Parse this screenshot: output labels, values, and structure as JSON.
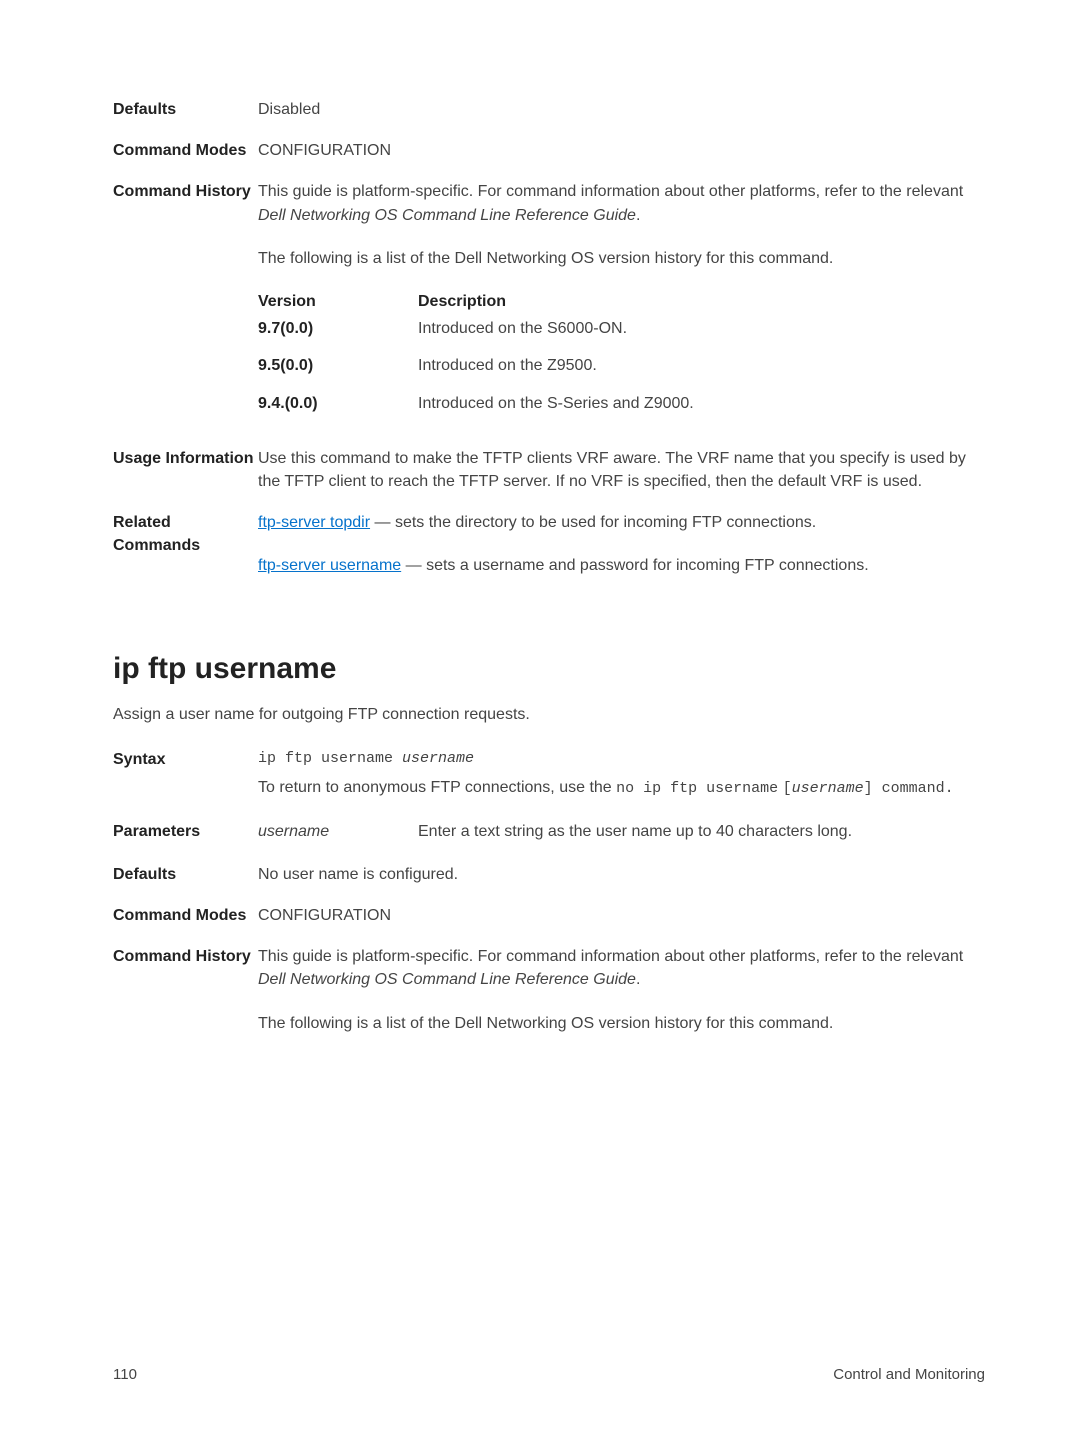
{
  "section1": {
    "defaults": {
      "label": "Defaults",
      "value": "Disabled"
    },
    "command_modes": {
      "label": "Command Modes",
      "value": "CONFIGURATION"
    },
    "command_history": {
      "label": "Command History",
      "intro_a": "This guide is platform-specific. For command information about other platforms, refer to the relevant ",
      "intro_italic": "Dell Networking OS Command Line Reference Guide",
      "intro_b": ".",
      "following": "The following is a list of the Dell Networking OS version history for this command.",
      "table": {
        "version_header": "Version",
        "description_header": "Description",
        "rows": [
          {
            "version": "9.7(0.0)",
            "description": "Introduced on the S6000-ON."
          },
          {
            "version": "9.5(0.0)",
            "description": "Introduced on the Z9500."
          },
          {
            "version": "9.4.(0.0)",
            "description": "Introduced on the S-Series and Z9000."
          }
        ]
      }
    },
    "usage_info": {
      "label": "Usage Information",
      "text": "Use this command to make the TFTP clients VRF aware. The VRF name that you specify is used by the TFTP client to reach the TFTP server. If no VRF is specified, then the default VRF is used."
    },
    "related_commands": {
      "label": "Related Commands",
      "item1_link": "ftp-server topdir",
      "item1_rest": " — sets the directory to be used for incoming FTP connections.",
      "item2_link": "ftp-server username",
      "item2_rest": " — sets a username and password for incoming FTP connections."
    }
  },
  "section2": {
    "title": "ip ftp username",
    "intro": "Assign a user name for outgoing FTP connection requests.",
    "syntax": {
      "label": "Syntax",
      "code_a": "ip ftp username ",
      "code_italic": "username",
      "line2_a": "To return to anonymous FTP connections, use the ",
      "line2_code1": "no ip ftp username",
      "line2_b": " [",
      "line2_code2_italic": "username",
      "line2_c": "] command."
    },
    "parameters": {
      "label": "Parameters",
      "name": "username",
      "desc": "Enter a text string as the user name up to 40 characters long."
    },
    "defaults": {
      "label": "Defaults",
      "value": "No user name is configured."
    },
    "command_modes": {
      "label": "Command Modes",
      "value": "CONFIGURATION"
    },
    "command_history": {
      "label": "Command History",
      "intro_a": "This guide is platform-specific. For command information about other platforms, refer to the relevant ",
      "intro_italic": "Dell Networking OS Command Line Reference Guide",
      "intro_b": ".",
      "following": "The following is a list of the Dell Networking OS version history for this command."
    }
  },
  "footer": {
    "page": "110",
    "section": "Control and Monitoring"
  }
}
